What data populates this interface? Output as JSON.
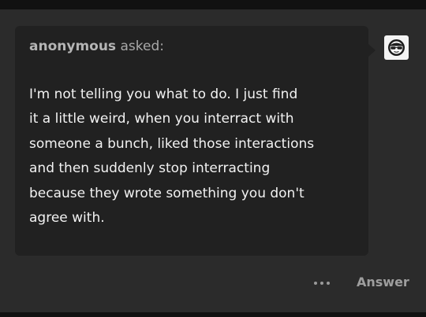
{
  "ask": {
    "asker_name": "anonymous",
    "asker_verb": "asked:",
    "question_lines": [
      "I'm not telling you what to do. I just find",
      "it a little weird, when you interract with",
      "someone a bunch, liked those interactions",
      "and then suddenly stop interracting",
      "because they wrote something you don't",
      "agree with."
    ]
  },
  "avatar": {
    "icon": "anonymous-sunglasses-avatar-icon"
  },
  "actions": {
    "more_icon": "more-horizontal-icon",
    "answer_label": "Answer"
  },
  "colors": {
    "page_background": "#111111",
    "card_background": "#2b2b2b",
    "bubble_background": "#212121",
    "question_text": "#f2f2f2",
    "muted_text": "#9e9e9e"
  }
}
